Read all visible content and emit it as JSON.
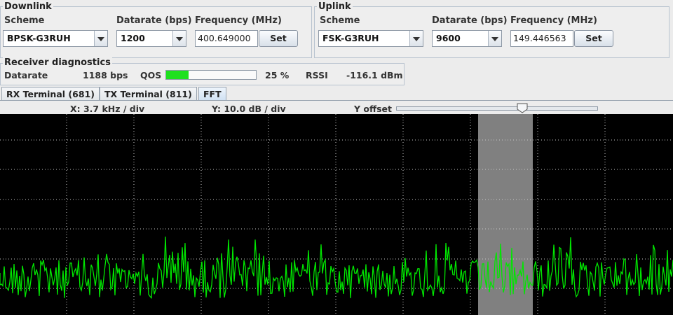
{
  "downlink": {
    "title": "Downlink",
    "scheme_label": "Scheme",
    "scheme_value": "BPSK-G3RUH",
    "datarate_label": "Datarate (bps)",
    "datarate_value": "1200",
    "frequency_label": "Frequency (MHz)",
    "frequency_value": "400.649000",
    "set_label": "Set"
  },
  "uplink": {
    "title": "Uplink",
    "scheme_label": "Scheme",
    "scheme_value": "FSK-G3RUH",
    "datarate_label": "Datarate (bps)",
    "datarate_value": "9600",
    "frequency_label": "Frequency (MHz)",
    "frequency_value": "149.446563",
    "set_label": "Set"
  },
  "diagnostics": {
    "title": "Receiver diagnostics",
    "datarate_label": "Datarate",
    "datarate_value": "1188 bps",
    "qos_label": "QOS",
    "qos_fraction": 0.25,
    "qos_percent": "25 %",
    "rssi_label": "RSSI",
    "rssi_value": "-116.1 dBm"
  },
  "tabs": [
    {
      "label": "RX Terminal (681)",
      "active": false
    },
    {
      "label": "TX Terminal (811)",
      "active": false
    },
    {
      "label": "FFT",
      "active": true
    }
  ],
  "fft": {
    "x_scale": "X: 3.7 kHz / div",
    "y_scale": "Y: 10.0 dB / div",
    "y_offset_label": "Y offset",
    "y_offset_fraction": 0.63,
    "trace_color": "#00e600",
    "background_color": "#000000",
    "marker_color": "#808080"
  },
  "colors": {
    "qos_bar": "#1fe01f",
    "window_bg": "#ececec"
  }
}
